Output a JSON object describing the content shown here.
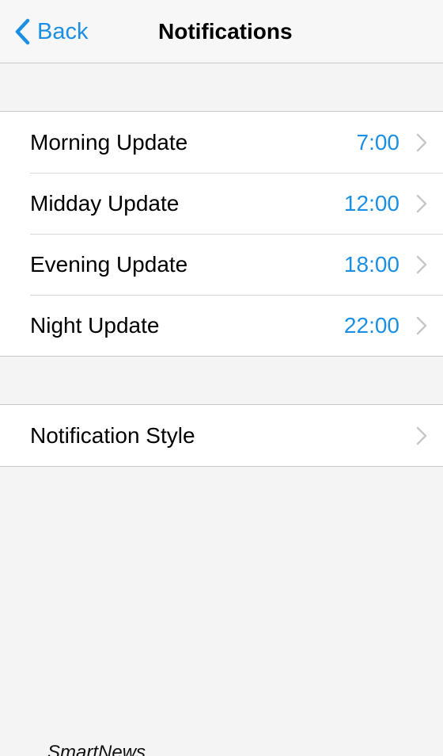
{
  "navbar": {
    "back_label": "Back",
    "title": "Notifications",
    "back_icon": "chevron-left-icon"
  },
  "update_times": [
    {
      "label": "Morning Update",
      "value": "7:00"
    },
    {
      "label": "Midday Update",
      "value": "12:00"
    },
    {
      "label": "Evening Update",
      "value": "18:00"
    },
    {
      "label": "Night Update",
      "value": "22:00"
    }
  ],
  "style_row": {
    "label": "Notification Style"
  },
  "footer": {
    "logo_text": "SmartNews"
  },
  "colors": {
    "accent": "#1a8fe3",
    "background": "#f4f4f4",
    "separator": "#c8c7cc",
    "chevron": "#c7c7cc"
  }
}
